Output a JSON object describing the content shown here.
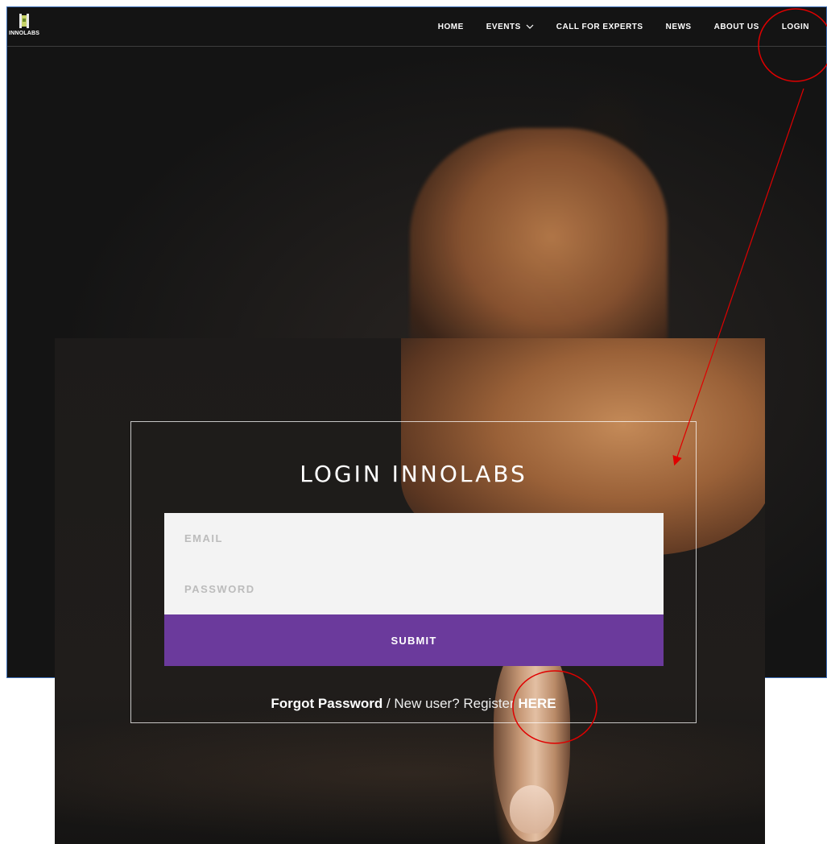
{
  "site": {
    "logo_text": "INNOLABS",
    "nav": {
      "home": "HOME",
      "events": "EVENTS",
      "call_for_experts": "CALL FOR EXPERTS",
      "news": "NEWS",
      "about_us": "ABOUT US",
      "login": "LOGIN"
    }
  },
  "login": {
    "title": "LOGIN INNOLABS",
    "email_placeholder": "EMAIL",
    "password_placeholder": "PASSWORD",
    "submit_label": "SUBMIT",
    "forgot_password": "Forgot Password",
    "separator": " / ",
    "new_user": "New user? Register ",
    "here": "HERE"
  },
  "colors": {
    "submit": "#6b3a9c",
    "annotation": "#e00000",
    "frame_border": "#3d6fb8"
  },
  "icons": [
    "logo-icon",
    "chevron-down-icon"
  ]
}
